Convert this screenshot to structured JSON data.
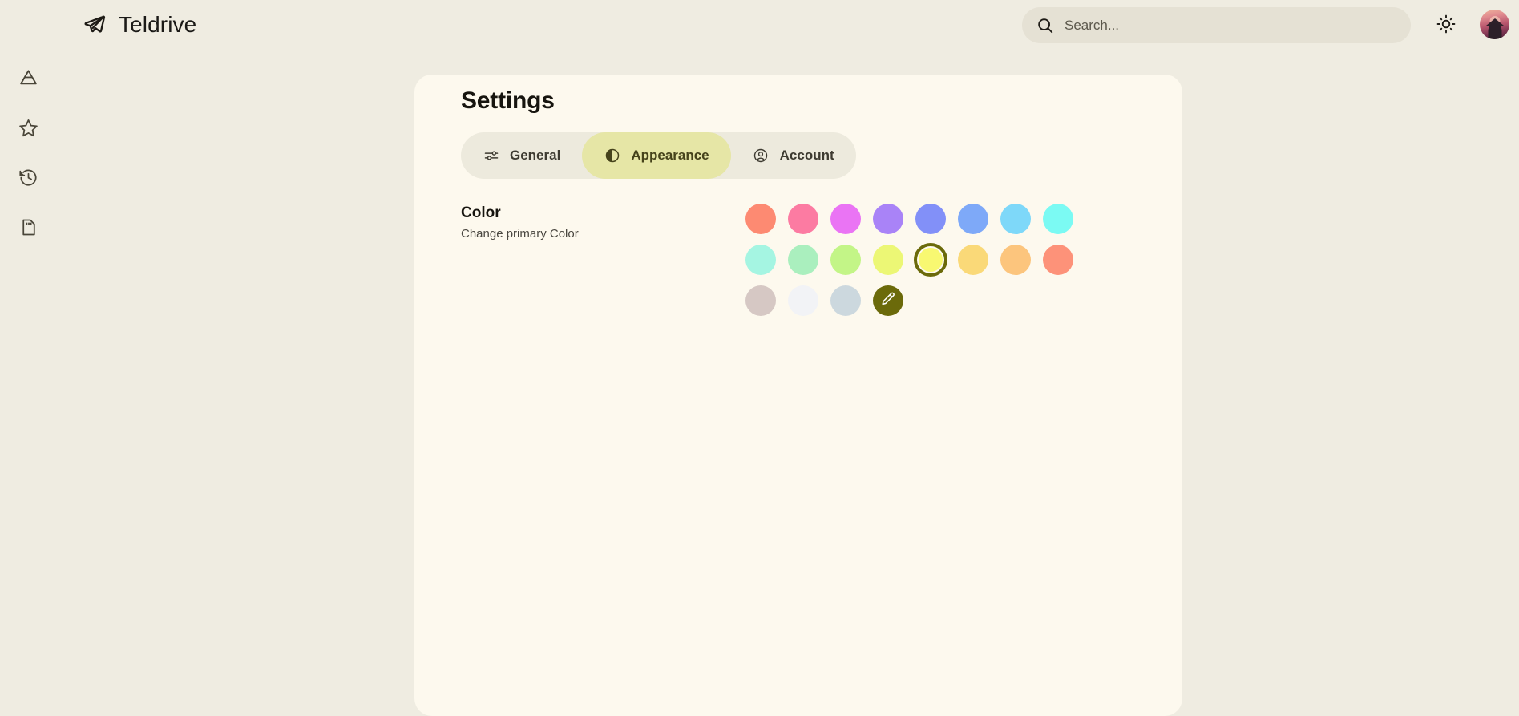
{
  "app": {
    "name": "Teldrive",
    "logo_icon": "paper-plane-icon"
  },
  "header": {
    "search": {
      "placeholder": "Search...",
      "value": "",
      "icon": "search-icon"
    },
    "theme_toggle_icon": "sun-icon",
    "avatar_label": "User avatar"
  },
  "sidebar": {
    "items": [
      {
        "icon": "drive-icon",
        "label": "Drive"
      },
      {
        "icon": "star-icon",
        "label": "Starred"
      },
      {
        "icon": "history-icon",
        "label": "Recent"
      },
      {
        "icon": "storage-icon",
        "label": "Storage"
      }
    ]
  },
  "main": {
    "title": "Settings",
    "tabs": [
      {
        "label": "General",
        "icon": "sliders-icon",
        "active": false
      },
      {
        "label": "Appearance",
        "icon": "contrast-icon",
        "active": true
      },
      {
        "label": "Account",
        "icon": "user-circle-icon",
        "active": false
      }
    ],
    "color_section": {
      "title": "Color",
      "subtitle": "Change primary Color",
      "selected_index": 12,
      "selected_color": "#f8f871",
      "selection_ring_color": "#6b6a0a",
      "swatches": [
        {
          "color": "#fd8a72",
          "name": "coral"
        },
        {
          "color": "#fc7ba2",
          "name": "pink"
        },
        {
          "color": "#ea74f4",
          "name": "magenta"
        },
        {
          "color": "#a983f7",
          "name": "purple"
        },
        {
          "color": "#8290f8",
          "name": "indigo"
        },
        {
          "color": "#7ea9f8",
          "name": "blue"
        },
        {
          "color": "#7ed8f9",
          "name": "sky"
        },
        {
          "color": "#7bfaf3",
          "name": "cyan"
        },
        {
          "color": "#a5f5e2",
          "name": "aquamarine"
        },
        {
          "color": "#aaefbe",
          "name": "mint"
        },
        {
          "color": "#c3f587",
          "name": "lime"
        },
        {
          "color": "#ecf775",
          "name": "yellow-green"
        },
        {
          "color": "#f8f871",
          "name": "yellow"
        },
        {
          "color": "#fad978",
          "name": "gold"
        },
        {
          "color": "#fcc57d",
          "name": "orange"
        },
        {
          "color": "#fd9279",
          "name": "salmon"
        },
        {
          "color": "#d6c8c4",
          "name": "taupe"
        },
        {
          "color": "#f2f3f6",
          "name": "white"
        },
        {
          "color": "#ccd8de",
          "name": "blue-gray"
        }
      ],
      "custom_picker": {
        "background": "#6b6a0a",
        "icon": "pencil-icon",
        "label": "Custom color"
      }
    }
  },
  "colors": {
    "page_background": "#efece1",
    "card_background": "#fdf9ee",
    "tab_strip_background": "#edeadd",
    "tab_active_background": "#e6e6a6",
    "search_background": "#e5e1d4",
    "text_primary": "#17150f",
    "text_secondary": "#4a4740"
  }
}
